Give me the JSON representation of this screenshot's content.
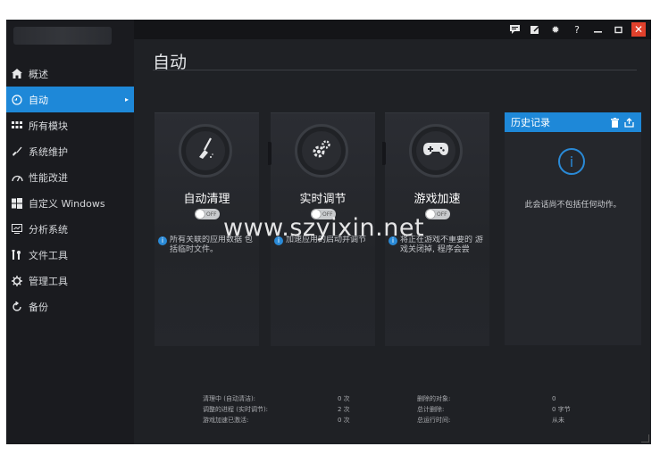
{
  "titlebar": {
    "icons": [
      "chat-icon",
      "edit-icon",
      "gear-icon",
      "help-icon",
      "minimize-icon",
      "restore-icon",
      "close-icon"
    ],
    "help_glyph": "?"
  },
  "sidebar": {
    "items": [
      {
        "label": "概述",
        "icon": "home-icon"
      },
      {
        "label": "自动",
        "icon": "auto-icon",
        "active": true
      },
      {
        "label": "所有模块",
        "icon": "grid-icon"
      },
      {
        "label": "系统维护",
        "icon": "broom-icon"
      },
      {
        "label": "性能改进",
        "icon": "gauge-icon"
      },
      {
        "label": "自定义 Windows",
        "icon": "windows-icon"
      },
      {
        "label": "分析系统",
        "icon": "analyze-icon"
      },
      {
        "label": "文件工具",
        "icon": "file-tools-icon"
      },
      {
        "label": "管理工具",
        "icon": "admin-tools-icon"
      },
      {
        "label": "备份",
        "icon": "backup-icon"
      }
    ]
  },
  "main": {
    "title": "自动",
    "cards": [
      {
        "name": "自动清理",
        "toggle": "OFF",
        "desc": "所有关联的应用数据 包括临时文件。"
      },
      {
        "name": "实时调节",
        "toggle": "OFF",
        "desc": "加速应用的启动并调节"
      },
      {
        "name": "游戏加速",
        "toggle": "OFF",
        "desc": "将正在游戏不重要的 游戏关闭掉, 程序会尝"
      }
    ],
    "history": {
      "title": "历史记录",
      "empty_text": "此会话尚不包括任何动作。"
    },
    "stats_left": [
      {
        "label": "清理中 (自动清洁):",
        "value": "0 次"
      },
      {
        "label": "调整的进程 (实时调节):",
        "value": "2 次"
      },
      {
        "label": "游戏加速已激活:",
        "value": "0 次"
      }
    ],
    "stats_right": [
      {
        "label": "删除的对象:",
        "value": "0"
      },
      {
        "label": "总计删除:",
        "value": "0 字节"
      },
      {
        "label": "总运行时间:",
        "value": "从未"
      }
    ]
  },
  "watermark": "www.szyixin.net",
  "colors": {
    "accent": "#1e88d8",
    "close": "#e0412c",
    "background": "#1f2125"
  }
}
